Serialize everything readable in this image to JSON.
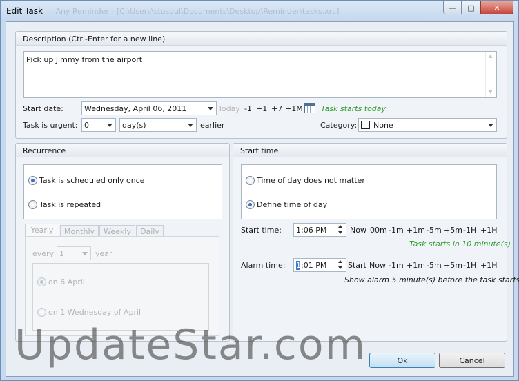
{
  "window": {
    "title": "Edit Task",
    "title_path": "- Any Reminder - [C:\\Users\\stosoul\\Documents\\Desktop\\Reminder\\tasks.xrc]",
    "buttons": {
      "minimize": "—",
      "maximize": "□",
      "close": "✕"
    }
  },
  "description": {
    "label": "Description (Ctrl-Enter for a new line)",
    "value": "Pick up Jimmy from the airport"
  },
  "start_date": {
    "label": "Start date:",
    "value": "Wednesday, April 06, 2011",
    "today": "Today",
    "shortcuts": [
      "-1",
      "+1",
      "+7",
      "+1M"
    ],
    "status": "Task starts today"
  },
  "urgency": {
    "label": "Task is urgent:",
    "amount": "0",
    "unit": "day(s)",
    "suffix": "earlier"
  },
  "category": {
    "label": "Category:",
    "value": "None"
  },
  "recurrence": {
    "title": "Recurrence",
    "once": "Task is scheduled only once",
    "repeated": "Task is repeated",
    "tabs": [
      "Yearly",
      "Monthly",
      "Weekly",
      "Daily"
    ],
    "every_label": "every",
    "every_value": "1",
    "every_unit": "year",
    "option_date": "on 6 April",
    "option_weekday": "on 1 Wednesday of April"
  },
  "start_time": {
    "title": "Start time",
    "dont_matter": "Time of day does not matter",
    "define": "Define time of day",
    "label": "Start time:",
    "value": "1:06 PM",
    "shortcuts": [
      "Now",
      "00m",
      "-1m",
      "+1m",
      "-5m",
      "+5m",
      "-1H",
      "+1H"
    ],
    "status": "Task starts in 10 minute(s)"
  },
  "alarm": {
    "label": "Alarm time:",
    "value_first": "1",
    "value_rest": ":01 PM",
    "shortcuts": [
      "Start",
      "Now",
      "-1m",
      "+1m",
      "-5m",
      "+5m",
      "-1H",
      "+1H"
    ],
    "status": "Show alarm 5 minute(s) before the task starts"
  },
  "footer": {
    "ok": "Ok",
    "cancel": "Cancel"
  },
  "watermark": "UpdateStar.com"
}
